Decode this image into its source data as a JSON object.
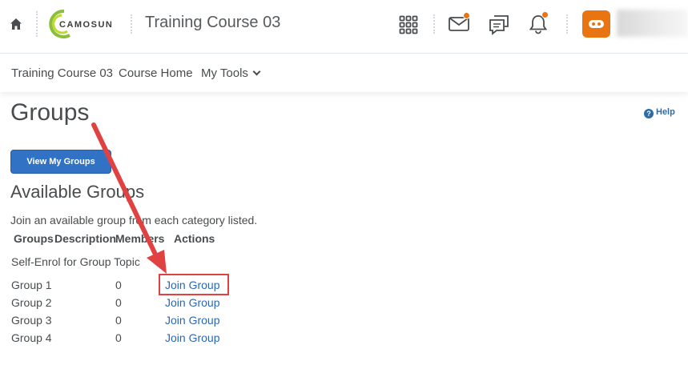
{
  "header": {
    "logo_text": "CAMOSUN",
    "course_title": "Training Course 03",
    "colors": {
      "accent": "#e87511",
      "link": "#2a68b4",
      "button": "#3172c4",
      "callout": "#e04242"
    },
    "icons": [
      "home-icon",
      "waffle-grid-icon",
      "mail-icon",
      "chat-icon",
      "bell-icon",
      "avatar-icon"
    ]
  },
  "navbar": {
    "items": [
      {
        "label": "Training Course 03"
      },
      {
        "label": "Course Home"
      },
      {
        "label": "My Tools"
      }
    ]
  },
  "page": {
    "title": "Groups",
    "help_label": "Help",
    "view_groups_button": "View My Groups",
    "section_heading": "Available Groups",
    "intro_text": "Join an available group from each category listed."
  },
  "table": {
    "columns": [
      "Groups",
      "Description",
      "Members",
      "Actions"
    ],
    "category": "Self-Enrol for Group Topic",
    "rows": [
      {
        "name": "Group 1",
        "members": "0",
        "action": "Join Group"
      },
      {
        "name": "Group 2",
        "members": "0",
        "action": "Join Group"
      },
      {
        "name": "Group 3",
        "members": "0",
        "action": "Join Group"
      },
      {
        "name": "Group 4",
        "members": "0",
        "action": "Join Group"
      }
    ]
  }
}
